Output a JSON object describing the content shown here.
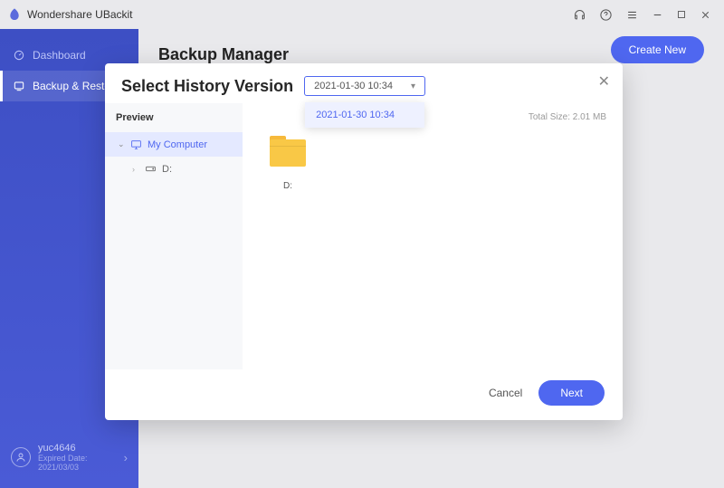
{
  "titlebar": {
    "app_name": "Wondershare UBackit"
  },
  "sidebar": {
    "items": [
      {
        "label": "Dashboard"
      },
      {
        "label": "Backup & Restore"
      }
    ],
    "user": {
      "name": "yuc4646",
      "expiry": "Expired Date: 2021/03/03"
    }
  },
  "main": {
    "heading": "Backup Manager",
    "create_label": "Create New"
  },
  "modal": {
    "title": "Select History Version",
    "selected_version": "2021-01-30 10:34",
    "version_options": [
      "2021-01-30 10:34"
    ],
    "preview_heading": "Preview",
    "tree": {
      "root": {
        "label": "My Computer"
      },
      "children": [
        {
          "label": "D:"
        }
      ]
    },
    "total_size_label": "Total Size: 2.01 MB",
    "folder": {
      "label": "D:"
    },
    "cancel_label": "Cancel",
    "next_label": "Next"
  }
}
